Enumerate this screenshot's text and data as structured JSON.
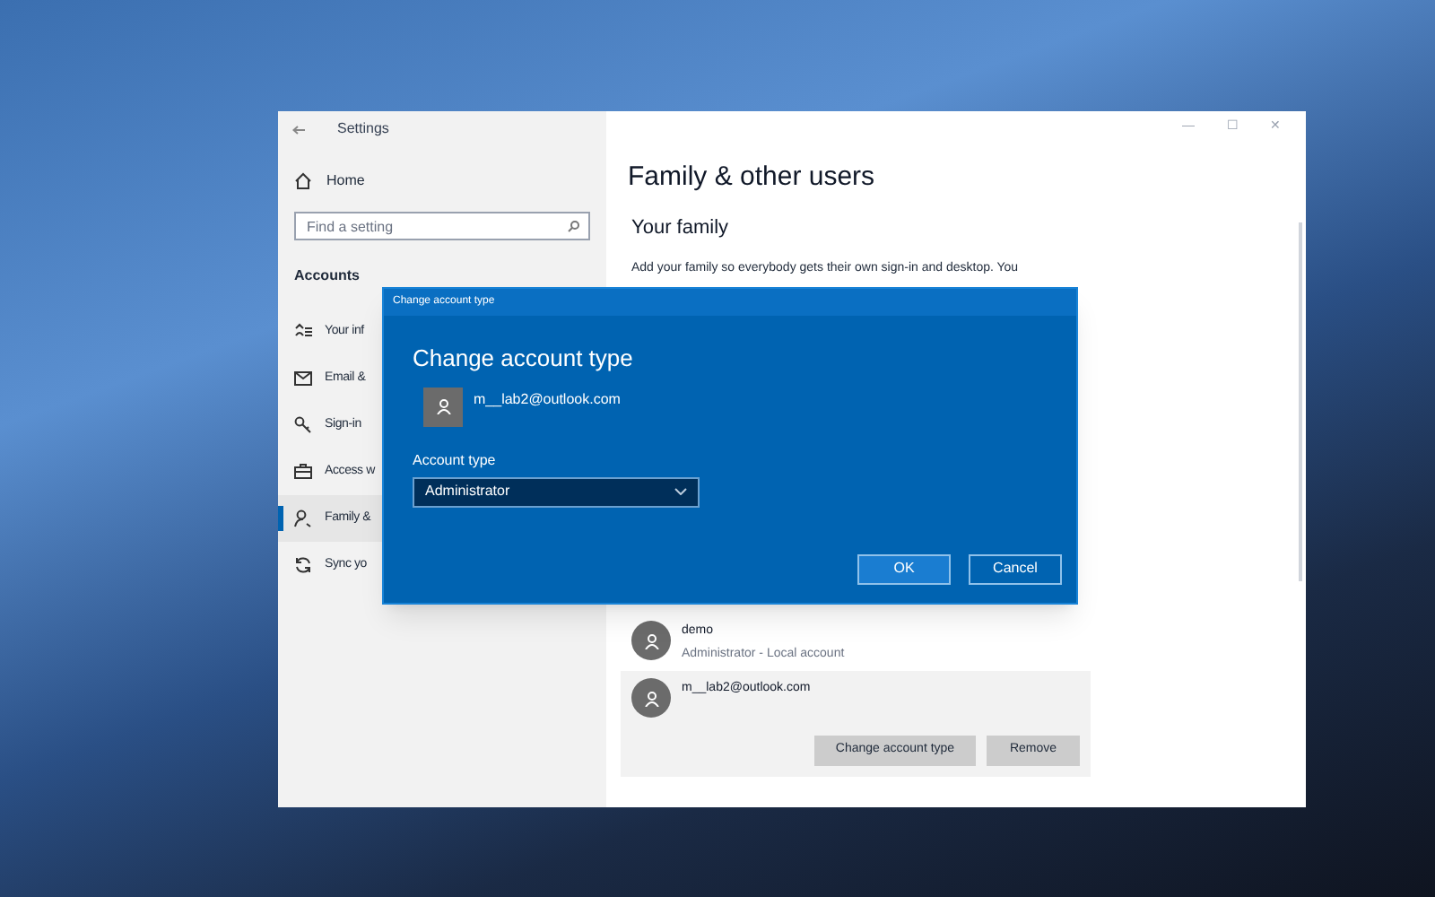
{
  "window": {
    "title": "Settings",
    "controls": [
      "—",
      "☐",
      "✕"
    ]
  },
  "sidebar": {
    "home": "Home",
    "search": {
      "placeholder": "Find a setting"
    },
    "section": "Accounts",
    "items": [
      {
        "label": "Your inf",
        "selected": false
      },
      {
        "label": "Email &",
        "selected": false
      },
      {
        "label": "Sign-in",
        "selected": false
      },
      {
        "label": "Access w",
        "selected": false
      },
      {
        "label": "Family &",
        "selected": true
      },
      {
        "label": "Sync yo",
        "selected": false
      }
    ]
  },
  "content": {
    "title": "Family & other users",
    "heading": "Your family",
    "description": [
      "Add your family so everybody gets their own sign-in and desktop. You"
    ],
    "users": [
      {
        "name": "demo",
        "detail": "Administrator - Local account",
        "expanded": false
      },
      {
        "name": "m__lab2@outlook.com",
        "expanded": true,
        "buttons": [
          "Change account type",
          "Remove"
        ]
      }
    ]
  },
  "dialog": {
    "title": "Change account type",
    "heading": "Change account type",
    "account": "m__lab2@outlook.com",
    "field_label": "Account type",
    "value": "Administrator",
    "buttons": [
      "OK",
      "Cancel"
    ]
  }
}
